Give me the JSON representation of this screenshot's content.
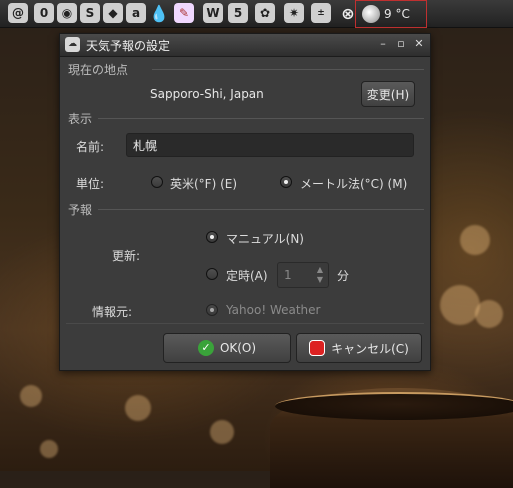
{
  "panel": {
    "icons": [
      "mail-icon",
      "info-icon",
      "globe-icon",
      "skype-icon",
      "dropbox-icon",
      "app-a-icon",
      "water-drop-icon",
      "paint-icon",
      "w-icon",
      "s-icon",
      "paw-icon",
      "pinwheel-icon",
      "calculator-icon",
      "close-circle-icon"
    ],
    "weather_temp": "9 °C"
  },
  "dialog": {
    "title": "天気予報の設定",
    "location_section": "現在の地点",
    "location_value": "Sapporo-Shi, Japan",
    "change_button": "変更(H)",
    "display_section": "表示",
    "name_label": "名前:",
    "name_value": "札幌",
    "unit_label": "単位:",
    "unit_imperial": "英米(°F) (E)",
    "unit_metric": "メートル法(°C) (M)",
    "forecast_section": "予報",
    "update_label": "更新:",
    "update_manual": "マニュアル(N)",
    "update_periodic": "定時(A)",
    "interval_value": "1",
    "interval_unit": "分",
    "source_label": "情報元:",
    "source_value": "Yahoo! Weather",
    "ok_button": "OK(O)",
    "cancel_button": "キャンセル(C)"
  },
  "colors": {
    "accent_red": "#c03030",
    "ok_green": "#3aa33a",
    "cancel_red": "#dd2222"
  }
}
